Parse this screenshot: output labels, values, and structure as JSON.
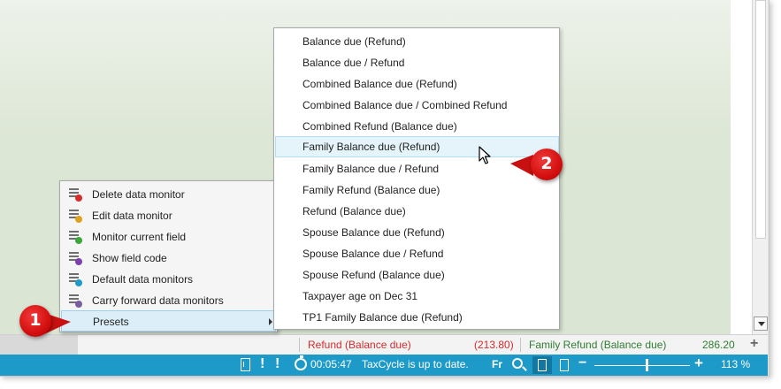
{
  "context_menu": {
    "items": [
      {
        "label": "Delete data monitor",
        "icon": "delete-monitor-icon",
        "badge_color": "#d62b2b"
      },
      {
        "label": "Edit data monitor",
        "icon": "edit-monitor-icon",
        "badge_color": "#e0a020"
      },
      {
        "label": "Monitor current field",
        "icon": "add-monitor-icon",
        "badge_color": "#3aa83a"
      },
      {
        "label": "Show field code",
        "icon": "show-field-code-icon",
        "badge_color": "#7a3fb0"
      },
      {
        "label": "Default data monitors",
        "icon": "default-monitors-icon",
        "badge_color": "#1e9ac8"
      },
      {
        "label": "Carry forward data monitors",
        "icon": "carry-forward-icon",
        "badge_color": "#7a5fa0"
      },
      {
        "label": "Presets",
        "icon": "",
        "badge_color": ""
      }
    ]
  },
  "presets_submenu": {
    "items": [
      "Balance due (Refund)",
      "Balance due / Refund",
      "Combined Balance due (Refund)",
      "Combined Balance due / Combined Refund",
      "Combined Refund (Balance due)",
      "Family Balance due (Refund)",
      "Family Balance due / Refund",
      "Family Refund (Balance due)",
      "Refund (Balance due)",
      "Spouse Balance due (Refund)",
      "Spouse Balance due / Refund",
      "Spouse Refund (Balance due)",
      "Taxpayer age on Dec 31",
      "TP1 Family Balance due (Refund)"
    ],
    "hovered": "Family Balance due (Refund)"
  },
  "monitor_bar": {
    "monitor1_label": "Refund (Balance due)",
    "monitor1_value": "(213.80)",
    "monitor2_label": "Family Refund (Balance due)",
    "monitor2_value": "286.20",
    "add_symbol": "+"
  },
  "status_bar": {
    "timer": "00:05:47",
    "message": "TaxCycle is up to date.",
    "language": "Fr",
    "zoom_minus": "−",
    "zoom_plus": "+",
    "zoom": "113 %",
    "zoom_level_percent": 113
  },
  "callouts": {
    "one": "1",
    "two": "2"
  },
  "colors": {
    "status_bar": "#1e9ac8",
    "callout": "#d40f0f",
    "negative_value": "#d62b2b",
    "positive_value": "#2e7d32",
    "hover": "#e5f3fb"
  }
}
